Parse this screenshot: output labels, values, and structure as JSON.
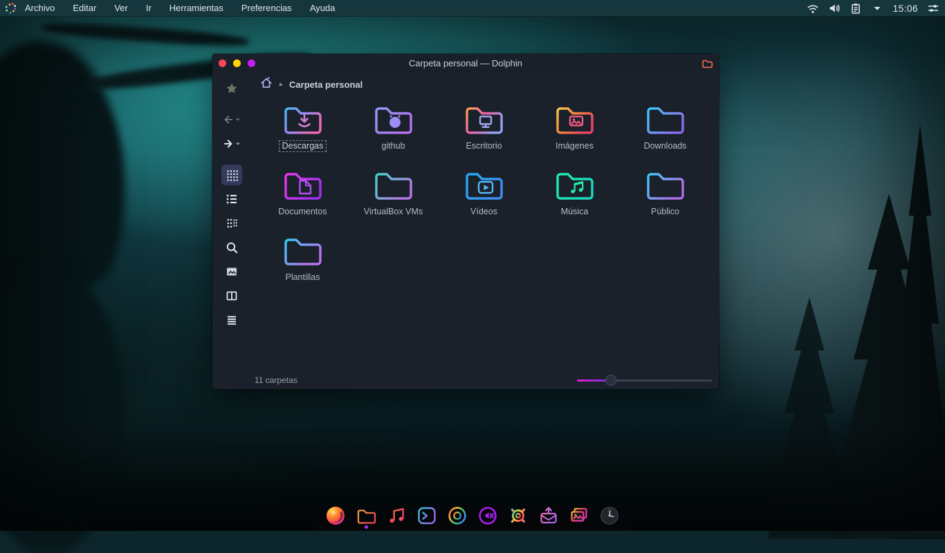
{
  "topbar": {
    "logo_icon": "distro-logo",
    "menu": [
      "Archivo",
      "Editar",
      "Ver",
      "Ir",
      "Herramientas",
      "Preferencias",
      "Ayuda"
    ],
    "tray_icons": [
      "wifi",
      "volume",
      "clipboard",
      "caret-down"
    ],
    "time": "15:06",
    "right_icon": "sliders"
  },
  "window": {
    "title": "Carpeta personal — Dolphin",
    "controls": [
      "close",
      "minimize",
      "maximize"
    ],
    "app_icon": "folder-icon",
    "breadcrumb": {
      "home_icon": "home",
      "separator": "▸",
      "label": "Carpeta personal"
    },
    "sidebar": [
      {
        "icon": "star",
        "dim": true,
        "group": "top"
      },
      {
        "icon": "back",
        "dim": true,
        "caret": true,
        "group": "nav"
      },
      {
        "icon": "forward",
        "dim": false,
        "caret": true,
        "group": "nav"
      },
      {
        "icon": "icons-view",
        "active": true,
        "group": "views"
      },
      {
        "icon": "list-view"
      },
      {
        "icon": "compact-view"
      },
      {
        "icon": "search"
      },
      {
        "icon": "preview"
      },
      {
        "icon": "split-view"
      },
      {
        "icon": "menu"
      }
    ],
    "folders": [
      {
        "label": "Descargas",
        "glyph": "download",
        "from": "#49b6f5",
        "mid": "#9a8af0",
        "to": "#f06ab4",
        "glyph_color": "#da7fd6",
        "selected": true
      },
      {
        "label": "github",
        "glyph": "github",
        "from": "#929cf5",
        "mid": "#a287f2",
        "to": "#b673f0",
        "glyph_color": "#9c8df2",
        "selected": false
      },
      {
        "label": "Escritorio",
        "glyph": "desktop",
        "from": "#f7a050",
        "mid": "#ee62a8",
        "to": "#8fa6f0",
        "glyph_color": "#a3a8f2",
        "selected": false
      },
      {
        "label": "Imágenes",
        "glyph": "image",
        "from": "#f5c84d",
        "mid": "#f5823d",
        "to": "#f04468",
        "glyph_color": "#f25a80",
        "selected": false
      },
      {
        "label": "Downloads",
        "glyph": "none",
        "from": "#38c8f2",
        "mid": "#6f9df0",
        "to": "#8e6cf0",
        "glyph_color": "",
        "selected": false
      },
      {
        "label": "Documentos",
        "glyph": "document",
        "from": "#ea3aea",
        "mid": "#c935f2",
        "to": "#a22ff5",
        "glyph_color": "#b54df2",
        "selected": false
      },
      {
        "label": "VirtualBox VMs",
        "glyph": "none",
        "from": "#3fd6c6",
        "mid": "#7fa8d8",
        "to": "#b877e8",
        "glyph_color": "",
        "selected": false
      },
      {
        "label": "Vídeos",
        "glyph": "video",
        "from": "#22aaf5",
        "mid": "#2f9ef5",
        "to": "#3f8ff5",
        "glyph_color": "#55b8f7",
        "selected": false
      },
      {
        "label": "Música",
        "glyph": "music",
        "from": "#25eab0",
        "mid": "#1fe2b8",
        "to": "#1adac2",
        "glyph_color": "#25eab0",
        "selected": false
      },
      {
        "label": "Público",
        "glyph": "none",
        "from": "#38c8f2",
        "mid": "#7f9ef0",
        "to": "#b36ce8",
        "glyph_color": "",
        "selected": false
      },
      {
        "label": "Plantillas",
        "glyph": "none",
        "from": "#38c8f5",
        "mid": "#7f9ef0",
        "to": "#bb73f0",
        "glyph_color": "",
        "selected": false
      }
    ],
    "status": {
      "left": "11 carpetas",
      "zoom_percent": 25
    }
  },
  "dock": [
    {
      "icon": "firefox",
      "active": false
    },
    {
      "icon": "file-manager",
      "active": true,
      "from": "#f5a03d",
      "to": "#f0485a"
    },
    {
      "icon": "music-player",
      "active": false,
      "from": "#f2683d",
      "to": "#f03d72"
    },
    {
      "icon": "terminal",
      "active": false,
      "from": "#38c8d8",
      "to": "#9a6cf0"
    },
    {
      "icon": "chromium",
      "active": false
    },
    {
      "icon": "media-player",
      "active": false,
      "from": "#b01ef5",
      "to": "#b01ef5"
    },
    {
      "icon": "settings",
      "active": false
    },
    {
      "icon": "mail-send",
      "active": false,
      "from": "#f56ab0",
      "to": "#a86cf0"
    },
    {
      "icon": "photos",
      "active": false
    },
    {
      "icon": "clock",
      "active": false
    }
  ],
  "colors": {
    "accent": "#b02ff0",
    "slider_fill_from": "#e020d0",
    "slider_fill_to": "#7a2be0",
    "traffic_close": "#fa4458",
    "traffic_min": "#ffd60a",
    "traffic_max": "#c41ef5"
  }
}
